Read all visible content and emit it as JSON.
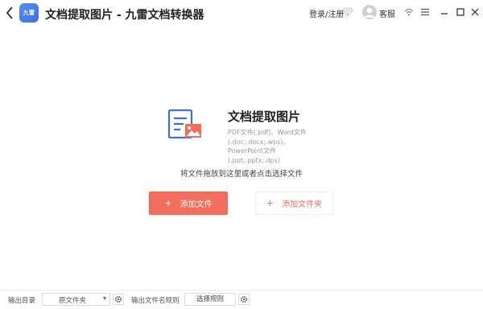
{
  "app": {
    "logo_text": "九雷",
    "window_title": "文档提取图片 - 九雷文档转换器"
  },
  "header": {
    "login_label": "登录/注册",
    "service_label": "客服"
  },
  "feature": {
    "title": "文档提取图片",
    "description": "PDF文件(.pdf)、Word文件(.doc;.docx;.wps)、PowerPoint文件(.ppt;.pptx;.dps)",
    "drop_hint": "将文件拖放到这里或者点击选择文件",
    "add_file_label": "添加文件",
    "add_folder_label": "添加文件夹",
    "plus": "+"
  },
  "bottom": {
    "output_dir_label": "输出目录",
    "output_dir_value": "原文件夹",
    "output_name_rule_label": "输出文件名规则",
    "choose_rule_label": "选择规则"
  },
  "colors": {
    "accent": "#f26d5b",
    "icon_blue": "#3c6fe0"
  },
  "icons": {
    "back": "chevron-left-icon",
    "vip": "diamond-icon",
    "wifi": "wifi-icon",
    "menu": "menu-icon",
    "minimize": "minimize-icon",
    "maximize": "maximize-icon",
    "close": "close-icon",
    "settings": "gear-icon"
  }
}
